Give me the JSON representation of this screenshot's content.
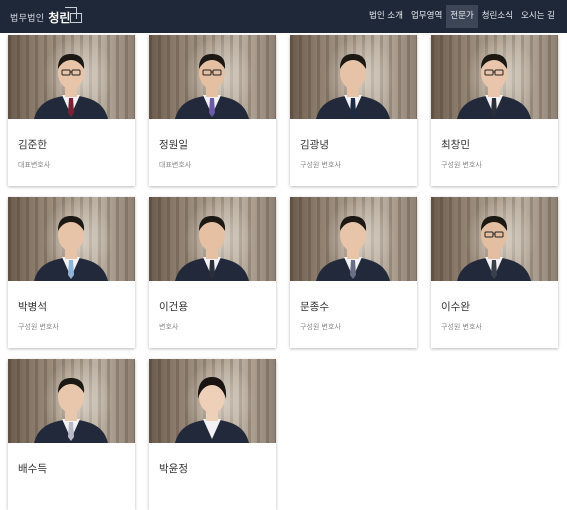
{
  "header": {
    "logo_sub": "법무법인",
    "logo_main": "청린",
    "menu": [
      {
        "label": "법인 소개"
      },
      {
        "label": "업무영역"
      },
      {
        "label": "전문가"
      },
      {
        "label": "청린소식"
      },
      {
        "label": "오시는 길"
      }
    ]
  },
  "lawyers": [
    {
      "name": "김준한",
      "role": "대표변호사"
    },
    {
      "name": "정원일",
      "role": "대표변호사"
    },
    {
      "name": "김광녕",
      "role": "구성원 변호사"
    },
    {
      "name": "최창민",
      "role": "구성원 변호사"
    },
    {
      "name": "박병석",
      "role": "구성원 변호사"
    },
    {
      "name": "이건용",
      "role": "변호사"
    },
    {
      "name": "문종수",
      "role": "구성원 변호사"
    },
    {
      "name": "이수완",
      "role": "구성원 변호사"
    },
    {
      "name": "배수득",
      "role": ""
    },
    {
      "name": "박윤정",
      "role": ""
    }
  ],
  "colors": {
    "navbar": "#1f2838",
    "menu_active": "#3c4656",
    "suit": "#22293a"
  }
}
